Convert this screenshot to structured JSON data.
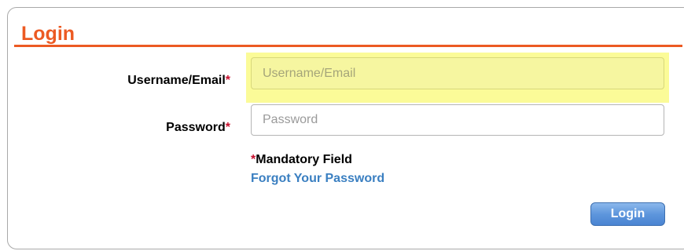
{
  "login_panel": {
    "title": "Login",
    "username": {
      "label": "Username/Email",
      "required_marker": "*",
      "placeholder": "Username/Email",
      "value": ""
    },
    "password": {
      "label": "Password",
      "required_marker": "*",
      "placeholder": "Password",
      "value": ""
    },
    "mandatory_note": {
      "marker": "*",
      "text": "Mandatory Field"
    },
    "forgot_password_link": "Forgot Your Password",
    "submit_button": "Login"
  },
  "colors": {
    "title_accent": "#ec5a23",
    "required_star": "#c8102e",
    "link": "#3a7fc1",
    "field_highlight": "#fbfb98",
    "button_blue": "#5e96dc"
  }
}
